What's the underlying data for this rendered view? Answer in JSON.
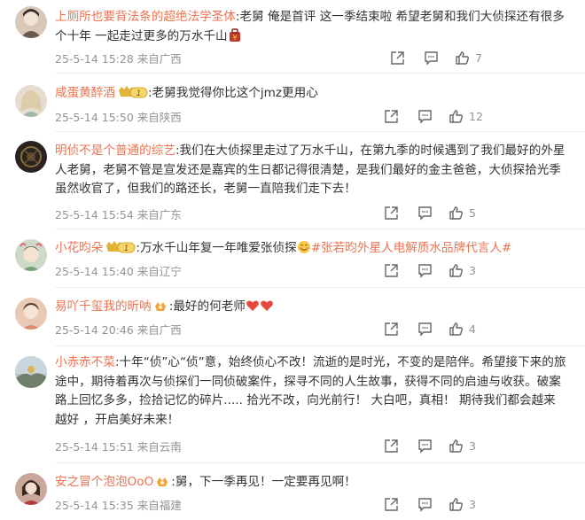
{
  "comments": [
    {
      "user": "上厕所也要背法条的超绝法学圣体",
      "text": ":老舅 俺是首评 这一季结束啦 希望老舅和我们大侦探还有很多个十年 一起走过更多的万水千山",
      "time": "25-5-14 15:28 来自广西",
      "likes": "7",
      "badge": false,
      "avatar_color": "#d9c7b8"
    },
    {
      "user": "咸蛋黄醉酒",
      "text": ":老舅我觉得你比这个jmz更用心",
      "time": "25-5-14 15:50 来自陕西",
      "likes": "12",
      "badge": true,
      "avatar_color": "#e6ddd0"
    },
    {
      "user": "明侦不是个普通的综艺",
      "text": ":我们在大侦探里走过了万水千山，在第九季的时候遇到了我们最好的外星人老舅，老舅不管是宣发还是嘉宾的生日都记得很清楚，是我们最好的金主爸爸，大侦探拾光季虽然收官了，但我们的路还长，老舅一直陪我们走下去！",
      "time": "25-5-14 15:54 来自广东",
      "likes": "5",
      "badge": false,
      "avatar_color": "#2a2320"
    },
    {
      "user": "小花昀朵",
      "text": ":万水千山年复一年唯爱张侦探",
      "topic": "#张若昀外星人电解质水品牌代言人#",
      "time": "25-5-14 15:40 来自辽宁",
      "likes": "3",
      "badge": true,
      "avatar_color": "#cfd9c8"
    },
    {
      "user": "易吖千玺我的昕呐",
      "text": ":最好的何老师",
      "time": "25-5-14 20:46 来自广西",
      "likes": "4",
      "badge": false,
      "avatar_color": "#e8c9b5"
    },
    {
      "user": "小赤赤不菜",
      "text": ":十年“侦”心“侦”意，始终侦心不改！流逝的是时光，不变的是陪伴。希望接下来的旅途中，期待着再次与侦探们一同侦破案件，探寻不同的人生故事，获得不同的启迪与收获。破案路上回忆多多，捡拾记忆的碎片..... 拾光不改，向光前行！ 大白吧，真相！ 期待我们都会越来越好 ，开启美好未来！",
      "time": "25-5-14 15:51 来自云南",
      "likes": "3",
      "badge": false,
      "avatar_color": "#b9c4cc"
    },
    {
      "user": "安之冒个泡泡OoO",
      "text": ":舅，下一季再见！一定要再见啊！",
      "time": "25-5-14 15:35 来自福建",
      "likes": "3",
      "badge": false,
      "avatar_color": "#c9a79a"
    }
  ]
}
